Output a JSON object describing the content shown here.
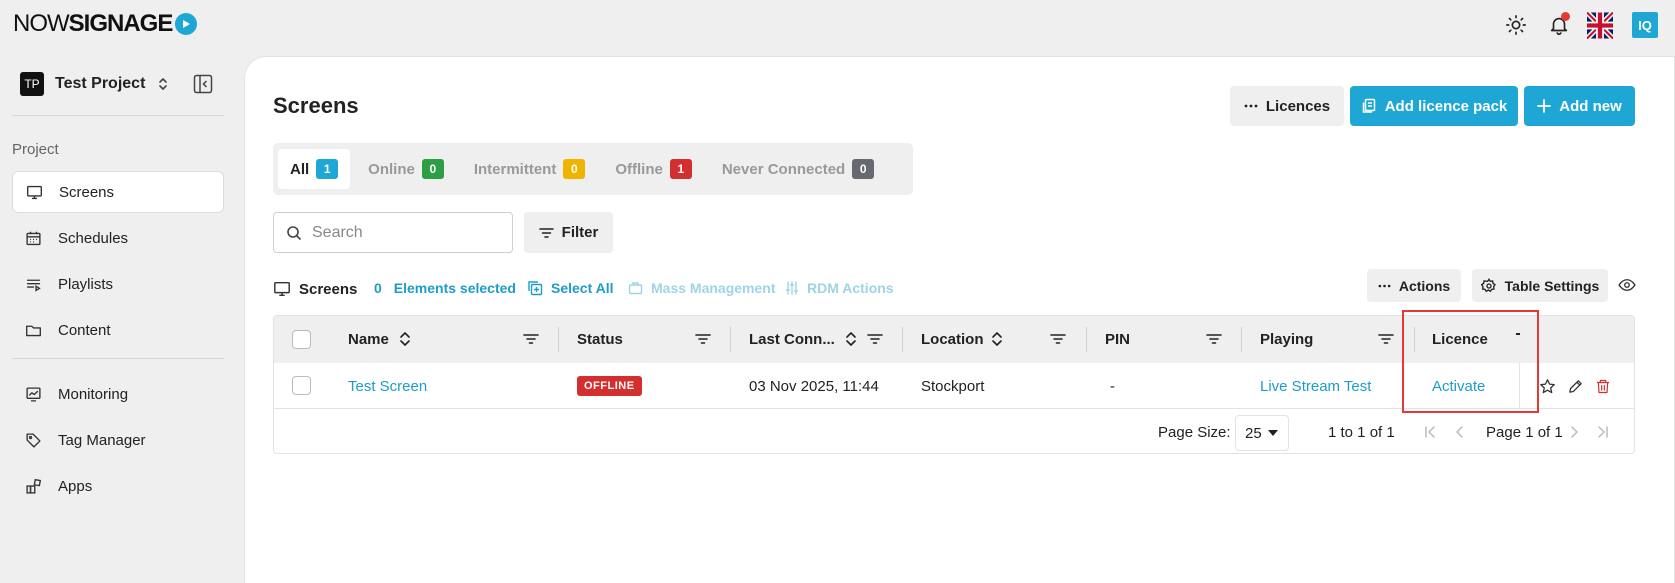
{
  "brand": {
    "logo_light": "NOW",
    "logo_bold": "SIGNAGE"
  },
  "topbar": {
    "user_initials": "IQ"
  },
  "sidebar": {
    "project_badge": "TP",
    "project_name": "Test Project",
    "section_label": "Project",
    "items": [
      {
        "label": "Screens",
        "icon": "monitor-icon",
        "active": true
      },
      {
        "label": "Schedules",
        "icon": "calendar-icon"
      },
      {
        "label": "Playlists",
        "icon": "playlist-icon"
      },
      {
        "label": "Content",
        "icon": "folder-icon"
      },
      {
        "label": "Monitoring",
        "icon": "chart-icon"
      },
      {
        "label": "Tag Manager",
        "icon": "tag-icon"
      },
      {
        "label": "Apps",
        "icon": "apps-icon"
      }
    ]
  },
  "page": {
    "title": "Screens",
    "licences_button": "Licences",
    "add_licence_pack_button": "Add licence pack",
    "add_new_button": "Add new"
  },
  "tabs": [
    {
      "label": "All",
      "count": "1",
      "color": "#1ea7d4"
    },
    {
      "label": "Online",
      "count": "0",
      "color": "#2e9e44"
    },
    {
      "label": "Intermittent",
      "count": "0",
      "color": "#f0b400"
    },
    {
      "label": "Offline",
      "count": "1",
      "color": "#d32f2f"
    },
    {
      "label": "Never Connected",
      "count": "0",
      "color": "#666a70"
    }
  ],
  "search": {
    "placeholder": "Search"
  },
  "filter_button": "Filter",
  "toolbar": {
    "screens_label": "Screens",
    "selected_count": "0",
    "elements_selected": "Elements selected",
    "select_all": "Select All",
    "mass_management": "Mass Management",
    "rdm_actions": "RDM Actions",
    "actions_button": "Actions",
    "table_settings_button": "Table Settings"
  },
  "table": {
    "columns": [
      "Name",
      "Status",
      "Last Conn...",
      "Location",
      "PIN",
      "Playing",
      "Licence"
    ],
    "rows": [
      {
        "name": "Test Screen",
        "status": "OFFLINE",
        "last_connected": "03 Nov 2025, 11:44",
        "location": "Stockport",
        "pin": "-",
        "playing": "Live Stream Test",
        "licence": "Activate"
      }
    ],
    "pagination": {
      "page_size_label": "Page Size:",
      "page_size": "25",
      "range": "1 to 1 of 1",
      "page_text": "Page 1 of 1"
    }
  }
}
